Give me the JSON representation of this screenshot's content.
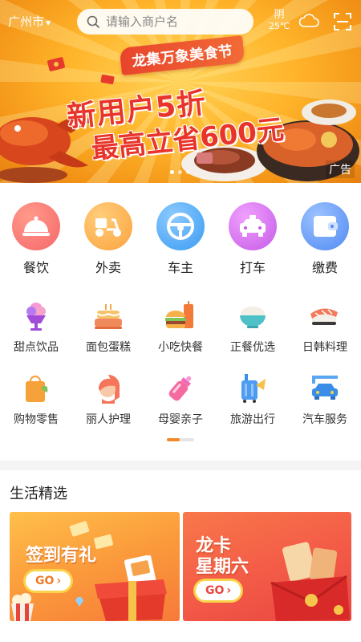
{
  "header": {
    "city": "广州市",
    "search_placeholder": "请输入商户名",
    "weather": {
      "condition": "阴",
      "temperature": "25℃"
    }
  },
  "banner": {
    "festival": "龙集万象美食节",
    "headline_1": "新用户5折",
    "headline_2": "最高立省600元",
    "ad_label": "广告",
    "slide_count": 3,
    "active_slide": 1
  },
  "main_categories": [
    {
      "label": "餐饮",
      "icon": "dining-cloche-icon",
      "color": "#f5676a"
    },
    {
      "label": "外卖",
      "icon": "scooter-icon",
      "color": "#fba33e"
    },
    {
      "label": "车主",
      "icon": "steering-wheel-icon",
      "color": "#3a9bf2"
    },
    {
      "label": "打车",
      "icon": "taxi-icon",
      "color": "#c65ae6"
    },
    {
      "label": "缴费",
      "icon": "wallet-icon",
      "color": "#4f8af2"
    }
  ],
  "sub_categories_row1": [
    {
      "label": "甜点饮品",
      "icon": "ice-cream-icon"
    },
    {
      "label": "面包蛋糕",
      "icon": "cake-icon"
    },
    {
      "label": "小吃快餐",
      "icon": "fast-food-icon"
    },
    {
      "label": "正餐优选",
      "icon": "rice-bowl-icon"
    },
    {
      "label": "日韩料理",
      "icon": "sushi-icon"
    }
  ],
  "sub_categories_row2": [
    {
      "label": "购物零售",
      "icon": "shopping-bag-icon"
    },
    {
      "label": "丽人护理",
      "icon": "beauty-icon"
    },
    {
      "label": "母婴亲子",
      "icon": "baby-bottle-icon"
    },
    {
      "label": "旅游出行",
      "icon": "luggage-icon"
    },
    {
      "label": "汽车服务",
      "icon": "car-wash-icon"
    }
  ],
  "pager": {
    "pages": 2,
    "active": 1
  },
  "life_section": {
    "title": "生活精选",
    "cards": [
      {
        "title": "签到有礼",
        "button": "GO",
        "theme": "#fb9a3b"
      },
      {
        "title_line1": "龙卡",
        "title_line2": "星期六",
        "button": "GO",
        "theme": "#f35a47"
      }
    ]
  }
}
